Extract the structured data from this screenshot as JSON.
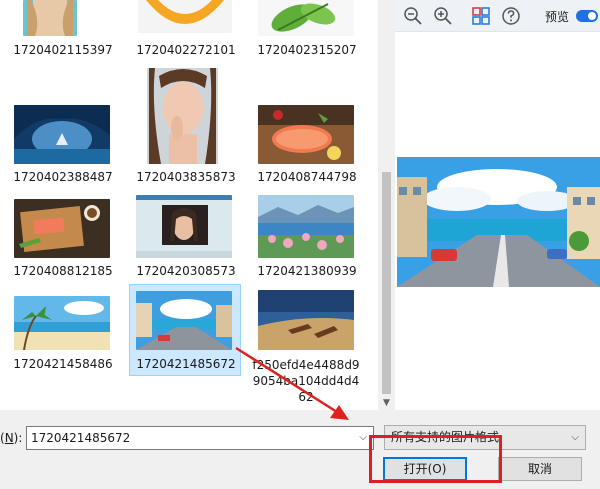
{
  "files": [
    {
      "name": "1720402115397"
    },
    {
      "name": "1720402272101"
    },
    {
      "name": "1720402315207"
    },
    {
      "name": "1720402388487"
    },
    {
      "name": "1720403835873"
    },
    {
      "name": "1720408744798"
    },
    {
      "name": "1720408812185"
    },
    {
      "name": "1720420308573"
    },
    {
      "name": "1720421380939"
    },
    {
      "name": "1720421458486"
    },
    {
      "name": "1720421485672",
      "selected": true
    },
    {
      "name": "f250efd4e4488d99054ba104dd4d462"
    }
  ],
  "preview": {
    "toolbar_icons": [
      "zoom-out-icon",
      "zoom-in-icon",
      "grid-icon",
      "help-icon"
    ],
    "label": "预览",
    "toggle_on": true
  },
  "filename": {
    "label_prefix": "(",
    "label_key": "N",
    "label_suffix": "):",
    "value": "1720421485672"
  },
  "filetype": {
    "selected": "所有支持的图片格式"
  },
  "buttons": {
    "open": "打开(O)",
    "cancel": "取消"
  },
  "colors": {
    "accent": "#1f6fe8",
    "selection": "#cce8ff",
    "annotation": "#e02020"
  }
}
